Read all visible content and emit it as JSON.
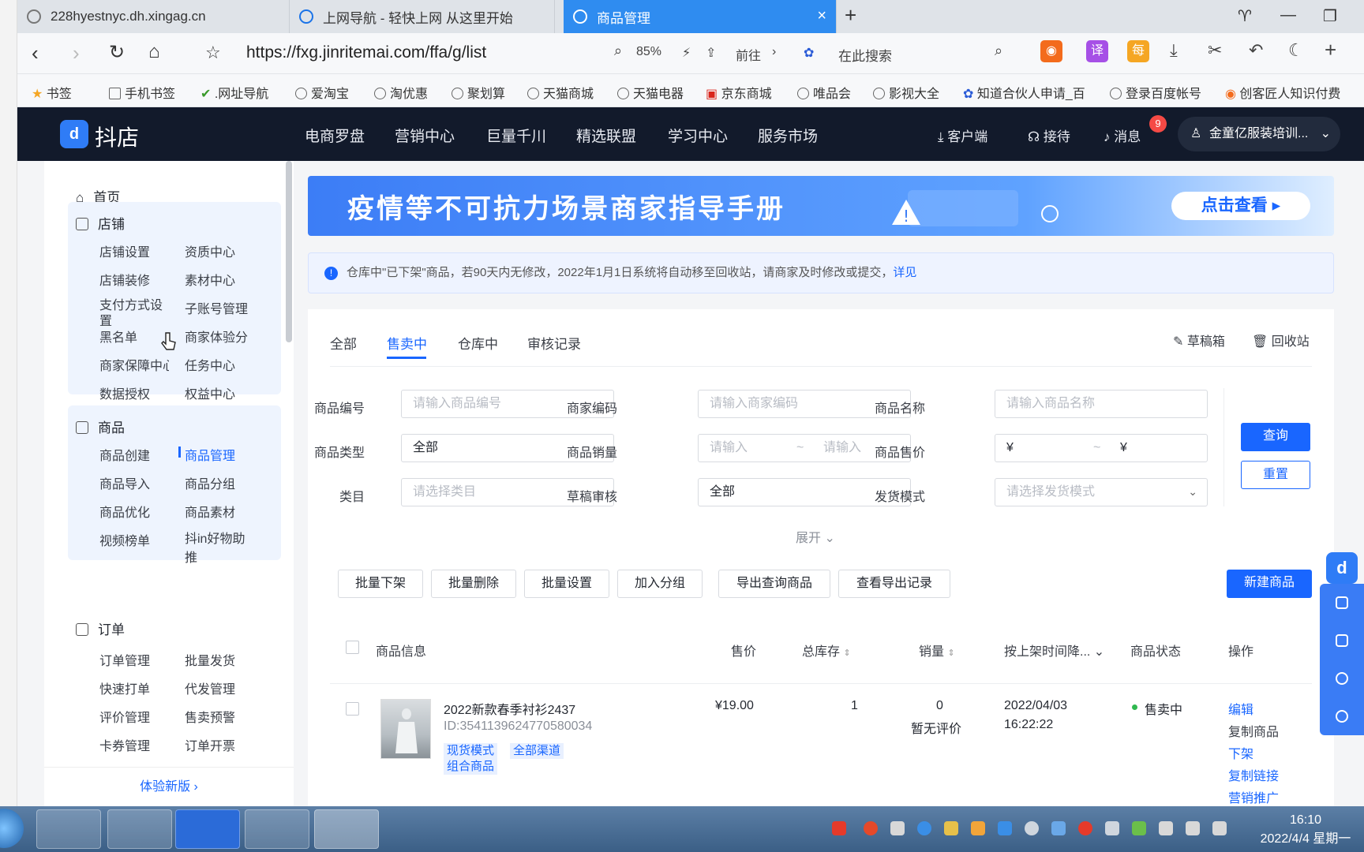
{
  "browser": {
    "tabs": [
      {
        "label": "228hyestnyc.dh.xingag.cn"
      },
      {
        "label": "上网导航 - 轻快上网 从这里开始"
      },
      {
        "label": "商品管理"
      }
    ],
    "url": "https://fxg.jinritemai.com/ffa/g/list",
    "zoom": "85%",
    "go_label": "前往",
    "search_placeholder": "在此搜索"
  },
  "bookmarks": [
    "书签",
    "手机书签",
    ".网址导航",
    "爱淘宝",
    "淘优惠",
    "聚划算",
    "天猫商城",
    "天猫电器",
    "京东商城",
    "唯品会",
    "影视大全",
    "知道合伙人申请_百",
    "登录百度帐号",
    "创客匠人知识付费"
  ],
  "app": {
    "brand": "抖店",
    "nav": [
      "电商罗盘",
      "营销中心",
      "巨量千川",
      "精选联盟",
      "学习中心",
      "服务市场"
    ],
    "right": {
      "client": "客户端",
      "reception": "接待",
      "messages": "消息",
      "message_count": "9",
      "account": "金童亿服装培训..."
    }
  },
  "sidebar": {
    "home": "首页",
    "store": {
      "title": "店铺",
      "items": [
        "店铺设置",
        "资质中心",
        "店铺装修",
        "素材中心",
        "支付方式设置",
        "子账号管理",
        "黑名单",
        "商家体验分",
        "商家保障中心",
        "任务中心",
        "数据授权",
        "权益中心"
      ]
    },
    "goods": {
      "title": "商品",
      "items": [
        "商品创建",
        "商品管理",
        "商品导入",
        "商品分组",
        "商品优化",
        "商品素材",
        "视频榜单",
        "抖in好物助推"
      ]
    },
    "orders": {
      "title": "订单",
      "items": [
        "订单管理",
        "批量发货",
        "快速打单",
        "代发管理",
        "评价管理",
        "售卖预警",
        "卡券管理",
        "订单开票"
      ]
    },
    "try_new": "体验新版"
  },
  "banner": {
    "title": "疫情等不可抗力场景商家指导手册",
    "button": "点击查看 ▸"
  },
  "notice": {
    "text": "仓库中\"已下架\"商品，若90天内无修改，2022年1月1日系统将自动移至回收站，请商家及时修改或提交，",
    "link": "详见"
  },
  "tabs": [
    "全部",
    "售卖中",
    "仓库中",
    "审核记录"
  ],
  "tab_links": {
    "drafts": "草稿箱",
    "recycle": "回收站"
  },
  "filters": {
    "product_id": {
      "label": "商品编号",
      "placeholder": "请输入商品编号"
    },
    "merchant_code": {
      "label": "商家编码",
      "placeholder": "请输入商家编码"
    },
    "product_name": {
      "label": "商品名称",
      "placeholder": "请输入商品名称"
    },
    "product_type": {
      "label": "商品类型",
      "value": "全部"
    },
    "sales": {
      "label": "商品销量",
      "min_placeholder": "请输入",
      "max_placeholder": "请输入",
      "sep": "~"
    },
    "price": {
      "label": "商品售价",
      "min": "¥",
      "max": "¥",
      "sep": "~"
    },
    "category": {
      "label": "类目",
      "placeholder": "请选择类目"
    },
    "draft_review": {
      "label": "草稿审核",
      "value": "全部"
    },
    "shipping_mode": {
      "label": "发货模式",
      "placeholder": "请选择发货模式"
    },
    "search": "查询",
    "reset": "重置",
    "expand": "展开"
  },
  "actions": [
    "批量下架",
    "批量删除",
    "批量设置",
    "加入分组",
    "导出查询商品",
    "查看导出记录"
  ],
  "new_product": "新建商品",
  "table": {
    "headers": [
      "商品信息",
      "售价",
      "总库存",
      "销量",
      "按上架时间降...",
      "商品状态",
      "操作"
    ],
    "rows": [
      {
        "title": "2022新款春季衬衫2437",
        "id": "ID:3541139624770580034",
        "tags": [
          "现货模式",
          "全部渠道",
          "组合商品"
        ],
        "price": "¥19.00",
        "stock": "1",
        "sales": "0",
        "rating": "暂无评价",
        "date": "2022/04/03",
        "time": "16:22:22",
        "status": "售卖中",
        "ops": [
          "编辑",
          "复制商品",
          "下架",
          "复制链接",
          "营销推广"
        ]
      }
    ]
  },
  "taskbar": {
    "time": "16:10",
    "date": "2022/4/4 星期一"
  }
}
